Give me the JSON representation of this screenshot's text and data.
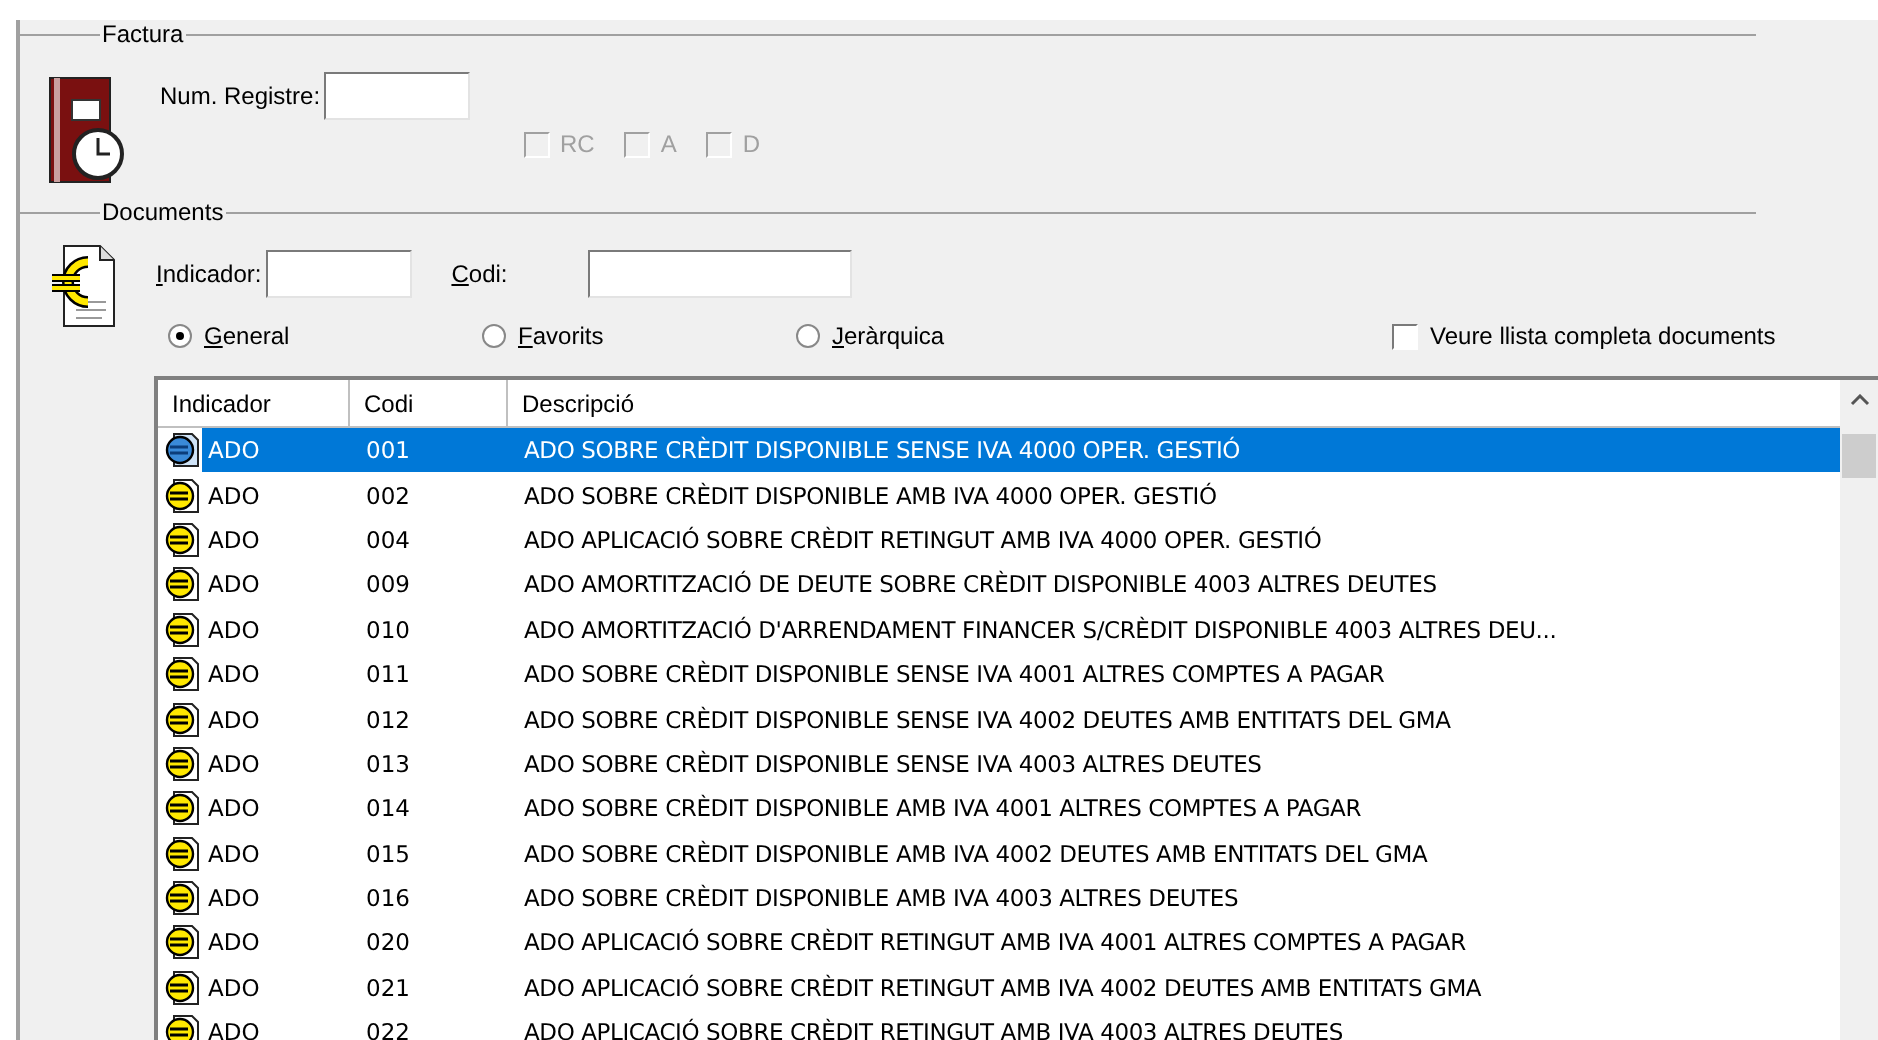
{
  "factura": {
    "title": "Factura",
    "num_registre": {
      "label": "Num. Registre:"
    },
    "checkboxes": [
      {
        "label": "RC",
        "checked": false,
        "disabled": true
      },
      {
        "label": "A",
        "checked": false,
        "disabled": true
      },
      {
        "label": "D",
        "checked": false,
        "disabled": true
      }
    ]
  },
  "documents": {
    "title": "Documents",
    "indicador": {
      "label": "Indicador:"
    },
    "codi": {
      "label": "Codi:"
    },
    "radios": [
      {
        "label": "General",
        "selected": true
      },
      {
        "label": "Favorits",
        "selected": false
      },
      {
        "label": "Jeràrquica",
        "selected": false
      }
    ],
    "full_list": {
      "label": "Veure llista completa documents",
      "checked": false
    }
  },
  "table": {
    "columns": [
      "Indicador",
      "Codi",
      "Descripció"
    ],
    "rows": [
      {
        "indicador": "ADO",
        "codi": "001",
        "descripcio": "ADO SOBRE CRÈDIT DISPONIBLE SENSE IVA 4000 OPER. GESTIÓ",
        "selected": true
      },
      {
        "indicador": "ADO",
        "codi": "002",
        "descripcio": "ADO SOBRE CRÈDIT DISPONIBLE AMB IVA 4000 OPER. GESTIÓ",
        "selected": false
      },
      {
        "indicador": "ADO",
        "codi": "004",
        "descripcio": "ADO APLICACIÓ SOBRE CRÈDIT RETINGUT AMB IVA 4000 OPER. GESTIÓ",
        "selected": false
      },
      {
        "indicador": "ADO",
        "codi": "009",
        "descripcio": "ADO AMORTITZACIÓ DE DEUTE SOBRE CRÈDIT DISPONIBLE 4003 ALTRES DEUTES",
        "selected": false
      },
      {
        "indicador": "ADO",
        "codi": "010",
        "descripcio": "ADO AMORTITZACIÓ D'ARRENDAMENT FINANCER S/CRÈDIT DISPONIBLE 4003 ALTRES DEU...",
        "selected": false
      },
      {
        "indicador": "ADO",
        "codi": "011",
        "descripcio": "ADO SOBRE CRÈDIT DISPONIBLE SENSE IVA 4001 ALTRES COMPTES A PAGAR",
        "selected": false
      },
      {
        "indicador": "ADO",
        "codi": "012",
        "descripcio": "ADO SOBRE CRÈDIT DISPONIBLE SENSE IVA 4002 DEUTES AMB ENTITATS DEL GMA",
        "selected": false
      },
      {
        "indicador": "ADO",
        "codi": "013",
        "descripcio": "ADO SOBRE CRÈDIT DISPONIBLE SENSE IVA 4003 ALTRES DEUTES",
        "selected": false
      },
      {
        "indicador": "ADO",
        "codi": "014",
        "descripcio": "ADO SOBRE CRÈDIT DISPONIBLE AMB IVA 4001 ALTRES COMPTES A PAGAR",
        "selected": false
      },
      {
        "indicador": "ADO",
        "codi": "015",
        "descripcio": "ADO SOBRE CRÈDIT DISPONIBLE AMB IVA 4002 DEUTES AMB ENTITATS DEL GMA",
        "selected": false
      },
      {
        "indicador": "ADO",
        "codi": "016",
        "descripcio": "ADO SOBRE CRÈDIT DISPONIBLE AMB IVA 4003 ALTRES DEUTES",
        "selected": false
      },
      {
        "indicador": "ADO",
        "codi": "020",
        "descripcio": "ADO APLICACIÓ SOBRE CRÈDIT RETINGUT AMB IVA 4001 ALTRES COMPTES A PAGAR",
        "selected": false
      },
      {
        "indicador": "ADO",
        "codi": "021",
        "descripcio": "ADO APLICACIÓ SOBRE CRÈDIT RETINGUT AMB IVA 4002 DEUTES AMB ENTITATS GMA",
        "selected": false
      },
      {
        "indicador": "ADO",
        "codi": "022",
        "descripcio": "ADO APLICACIÓ SOBRE CRÈDIT RETINGUT AMB IVA 4003 ALTRES DEUTES",
        "selected": false
      }
    ]
  }
}
